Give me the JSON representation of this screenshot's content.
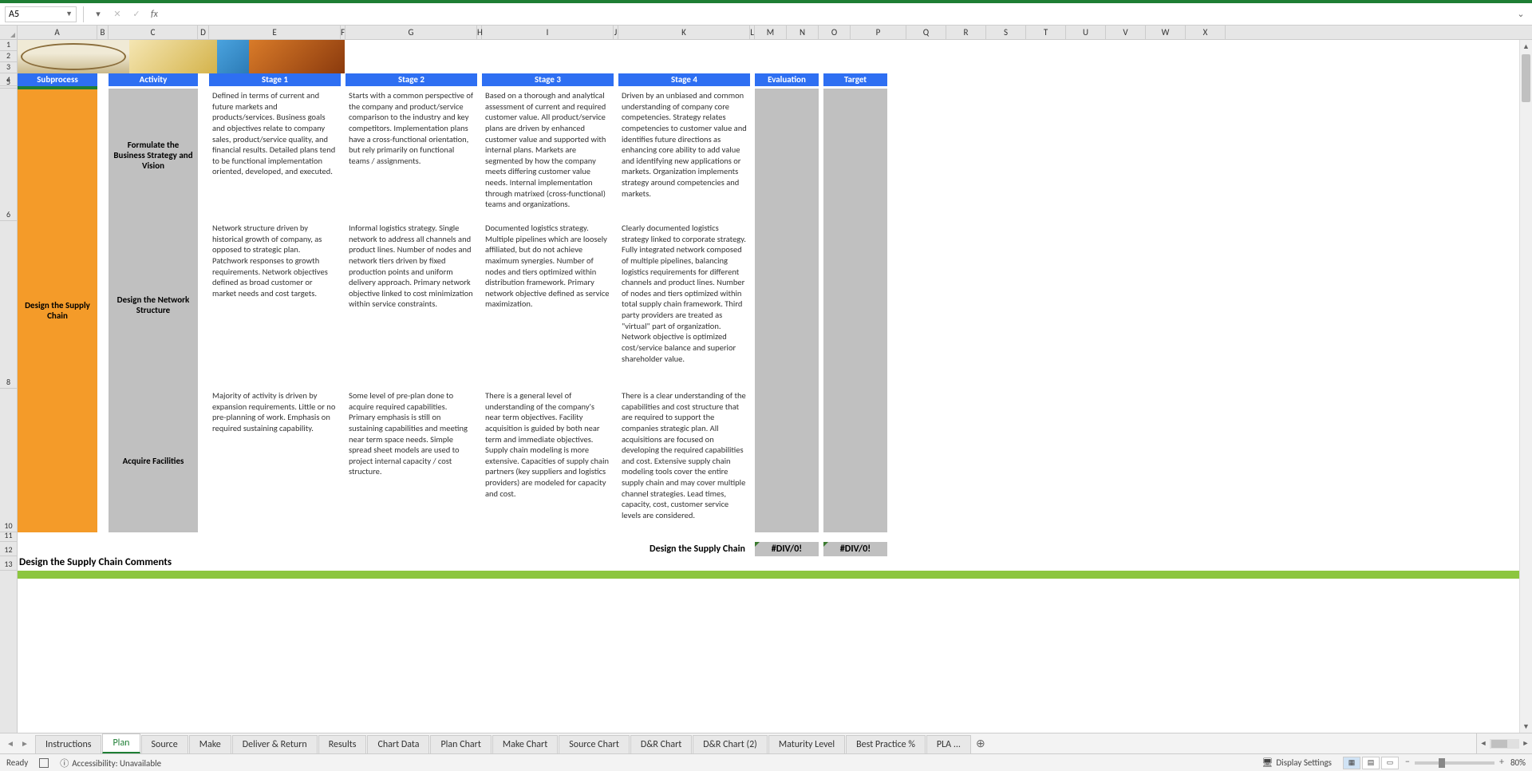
{
  "name_box": "A5",
  "formula_value": "",
  "columns": [
    "A",
    "B",
    "C",
    "D",
    "E",
    "F",
    "G",
    "H",
    "I",
    "J",
    "K",
    "L",
    "M",
    "N",
    "O",
    "P",
    "Q",
    "R",
    "S",
    "T",
    "U",
    "V",
    "W",
    "X"
  ],
  "row_nums": [
    "1",
    "2",
    "3",
    "4",
    "5",
    "6",
    "8",
    "10",
    "11",
    "12",
    "13"
  ],
  "headers": {
    "subprocess": "Subprocess",
    "activity": "Activity",
    "stage1": "Stage 1",
    "stage2": "Stage 2",
    "stage3": "Stage 3",
    "stage4": "Stage 4",
    "evaluation": "Evaluation",
    "target": "Target"
  },
  "subprocess": "Design the Supply Chain",
  "activities": [
    {
      "name": "Formulate the Business Strategy and Vision",
      "s1": "Defined in terms of current and future markets and products/services.  Business goals and objectives relate to company sales, product/service quality, and financial results.  Detailed plans tend to be functional implementation oriented, developed, and executed.",
      "s2": "Starts with a common perspective of the company and product/service comparison to the industry and key competitors.  Implementation plans have a cross-functional orientation, but rely primarily on functional teams / assignments.",
      "s3": "Based on a thorough and analytical assessment of current and required customer value.  All product/service plans are driven by enhanced customer value and supported with internal plans.  Markets are segmented by how the company meets differing customer value needs.  Internal implementation through matrixed (cross-functional) teams and organizations.",
      "s4": "Driven by an unbiased and common understanding of company core competencies.  Strategy relates competencies to customer value and identifies future directions as enhancing core ability to add value and identifying new applications or markets.  Organization implements strategy around competencies and markets."
    },
    {
      "name": "Design the Network Structure",
      "s1": "Network structure driven by historical growth of company, as opposed to strategic plan.  Patchwork responses to growth requirements.  Network objectives defined as broad customer or market needs and cost targets.",
      "s2": "Informal logistics strategy.  Single network to address all channels and product lines.  Number of nodes and network tiers driven by fixed production points and uniform delivery approach.  Primary network objective linked to cost minimization within service constraints.",
      "s3": "Documented logistics strategy.  Multiple pipelines which are loosely affiliated, but do not achieve maximum synergies.  Number of nodes and tiers optimized within distribution framework.  Primary network objective defined as service maximization.",
      "s4": "Clearly documented logistics strategy linked to corporate strategy.  Fully integrated network composed of multiple pipelines, balancing logistics requirements for different channels and product lines.  Number of nodes and tiers optimized within total supply chain framework.  Third party providers are treated as \"virtual\" part of organization.  Network objective is optimized cost/service balance and superior shareholder value."
    },
    {
      "name": "Acquire Facilities",
      "s1": "Majority of activity is driven by expansion requirements.  Little or no pre-planning of work.  Emphasis on required sustaining capability.",
      "s2": "Some level of pre-plan done to acquire required capabilities.  Primary emphasis is still on sustaining capabilities and meeting near term space needs.  Simple spread sheet models are used to project internal capacity / cost structure.",
      "s3": "There is a general level of understanding of the company's near term objectives.  Facility acquisition is guided by both near term and immediate objectives.  Supply chain modeling is more extensive.  Capacities of supply chain partners (key suppliers and logistics providers) are modeled for capacity and cost.",
      "s4": "There is a clear understanding of the capabilities and cost structure that are required to support the companies strategic plan.  All acquisitions are focused on developing the required capabilities and cost.  Extensive supply chain modeling tools cover the entire supply chain and may cover multiple channel strategies.  Lead times, capacity, cost, customer service levels are considered."
    }
  ],
  "summary": {
    "label": "Design the Supply Chain",
    "eval_err": "#DIV/0!",
    "target_err": "#DIV/0!"
  },
  "comments_label": "Design the Supply Chain Comments",
  "tabs": [
    "Instructions",
    "Plan",
    "Source",
    "Make",
    "Deliver & Return",
    "Results",
    "Chart Data",
    "Plan Chart",
    "Make Chart",
    "Source Chart",
    "D&R Chart",
    "D&R Chart (2)",
    "Maturity Level",
    "Best Practice %",
    "PLA ..."
  ],
  "active_tab": "Plan",
  "status": {
    "ready": "Ready",
    "accessibility": "Accessibility: Unavailable",
    "display_settings": "Display Settings",
    "zoom": "80%"
  }
}
